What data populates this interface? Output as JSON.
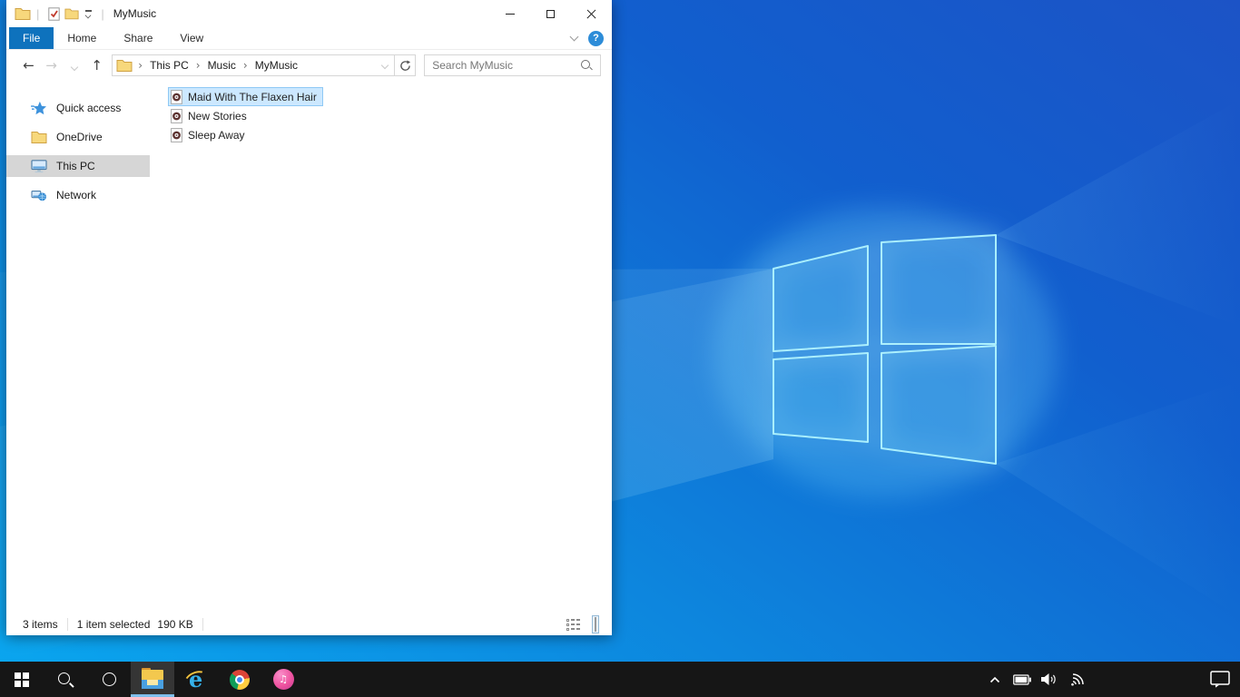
{
  "colors": {
    "accent_tab": "#0e72bd",
    "selection_bg": "#cce8ff",
    "selection_border": "#8fc9f5",
    "sidebar_selected_bg": "#d6d6d6",
    "taskbar_bg": "#161616",
    "taskbar_active_underline": "#7ebfec",
    "wallpaper_top": "#1c53c6",
    "wallpaper_bottom": "#0aa5ee",
    "logo_edge": "#9feafc"
  },
  "icons": {
    "back": "←",
    "forward": "→",
    "up": "↑",
    "breadcrumb_sep": "›",
    "help": "?",
    "music_note": "♫"
  },
  "window": {
    "title": "MyMusic",
    "tabs": [
      {
        "label": "File",
        "active": true
      },
      {
        "label": "Home",
        "active": false
      },
      {
        "label": "Share",
        "active": false
      },
      {
        "label": "View",
        "active": false
      }
    ],
    "address": {
      "crumbs": [
        "This PC",
        "Music",
        "MyMusic"
      ],
      "search_placeholder": "Search MyMusic"
    },
    "sidebar": {
      "items": [
        {
          "label": "Quick access",
          "icon": "quick-access-star",
          "selected": false
        },
        {
          "label": "OneDrive",
          "icon": "onedrive-folder",
          "selected": false
        },
        {
          "label": "This PC",
          "icon": "this-pc-monitor",
          "selected": true
        },
        {
          "label": "Network",
          "icon": "network-computers",
          "selected": false
        }
      ]
    },
    "files": {
      "items": [
        {
          "name": "Maid With The Flaxen Hair",
          "icon": "audio-file",
          "selected": true
        },
        {
          "name": "New Stories",
          "icon": "audio-file",
          "selected": false
        },
        {
          "name": "Sleep Away",
          "icon": "audio-file",
          "selected": false
        }
      ]
    },
    "status": {
      "count": "3 items",
      "selected": "1 item selected",
      "size": "190 KB"
    }
  },
  "taskbar": {
    "apps": [
      "start",
      "search",
      "cortana",
      "file-explorer",
      "internet-explorer",
      "chrome",
      "itunes"
    ],
    "active_app": "file-explorer",
    "tray": [
      "hidden-icons-chevron",
      "battery",
      "volume",
      "wifi",
      "action-center"
    ]
  }
}
